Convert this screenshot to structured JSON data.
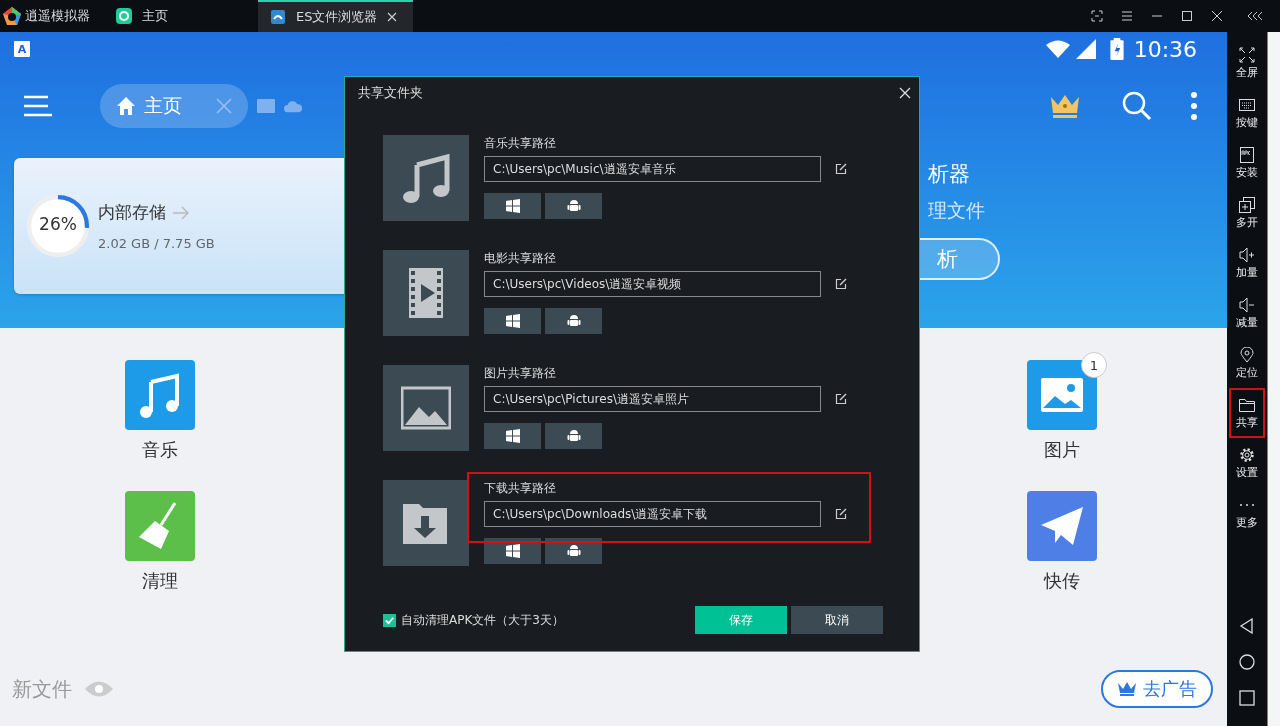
{
  "titlebar": {
    "app_name": "逍遥模拟器",
    "tabs": [
      {
        "label": "主页",
        "selected": false,
        "kind": "home"
      },
      {
        "label": "ES文件浏览器",
        "selected": true,
        "kind": "es"
      }
    ]
  },
  "status_bar": {
    "notification": "A",
    "time": "10:36"
  },
  "toolbar": {
    "tab_label": "主页"
  },
  "storage": {
    "percent": "26%",
    "level": 0.26,
    "title": "内部存储",
    "size": "2.02 GB / 7.75 GB"
  },
  "analyzer": {
    "title": "析器",
    "subtitle": "理文件",
    "button": "析"
  },
  "categories": [
    {
      "label": "音乐",
      "kind": "music"
    },
    {
      "label": "清理",
      "kind": "clean"
    },
    {
      "label": "图片",
      "kind": "picture",
      "badge": "1"
    },
    {
      "label": "快传",
      "kind": "send"
    }
  ],
  "recent": {
    "title": "新文件",
    "ad_button": "去广告"
  },
  "sidebar": {
    "items": [
      {
        "label": "全屏",
        "kind": "fullscreen",
        "highlighted": false
      },
      {
        "label": "按键",
        "kind": "keyboard",
        "highlighted": false
      },
      {
        "label": "安装",
        "kind": "apk",
        "highlighted": false
      },
      {
        "label": "多开",
        "kind": "multi",
        "highlighted": false
      },
      {
        "label": "加量",
        "kind": "volup",
        "highlighted": false
      },
      {
        "label": "减量",
        "kind": "voldown",
        "highlighted": false
      },
      {
        "label": "定位",
        "kind": "location",
        "highlighted": false
      },
      {
        "label": "共享",
        "kind": "folder",
        "highlighted": true
      },
      {
        "label": "设置",
        "kind": "settings",
        "highlighted": false
      },
      {
        "label": "更多",
        "kind": "more",
        "highlighted": false
      }
    ]
  },
  "dialog": {
    "title": "共享文件夹",
    "folders": [
      {
        "label": "音乐共享路径",
        "path": "C:\\Users\\pc\\Music\\逍遥安卓音乐",
        "kind": "music",
        "highlighted": false
      },
      {
        "label": "电影共享路径",
        "path": "C:\\Users\\pc\\Videos\\逍遥安卓视频",
        "kind": "video",
        "highlighted": false
      },
      {
        "label": "图片共享路径",
        "path": "C:\\Users\\pc\\Pictures\\逍遥安卓照片",
        "kind": "picture",
        "highlighted": false
      },
      {
        "label": "下载共享路径",
        "path": "C:\\Users\\pc\\Downloads\\逍遥安卓下载",
        "kind": "download",
        "highlighted": true
      }
    ],
    "auto_clean": {
      "label": "自动清理APK文件（大于3天）",
      "checked": true
    },
    "save": "保存",
    "cancel": "取消"
  }
}
